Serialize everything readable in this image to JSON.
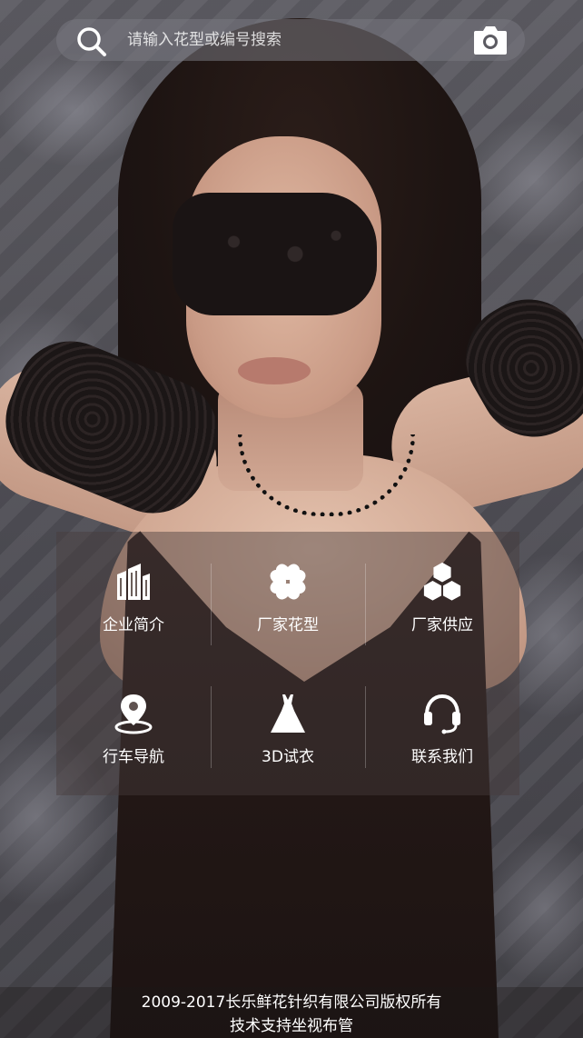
{
  "search": {
    "placeholder": "请输入花型或编号搜索"
  },
  "menu": {
    "items": [
      {
        "label": "企业简介",
        "icon": "building-icon"
      },
      {
        "label": "厂家花型",
        "icon": "clover-icon"
      },
      {
        "label": "厂家供应",
        "icon": "hexagons-icon"
      },
      {
        "label": "行车导航",
        "icon": "location-pin-icon"
      },
      {
        "label": "3D试衣",
        "icon": "dress-icon"
      },
      {
        "label": "联系我们",
        "icon": "headset-icon"
      }
    ]
  },
  "footer": {
    "copyright": "2009-2017长乐鲜花针织有限公司版权所有",
    "support": "技术支持坐视布管"
  },
  "colors": {
    "icon": "#ffffff",
    "panel": "#463c3c"
  }
}
